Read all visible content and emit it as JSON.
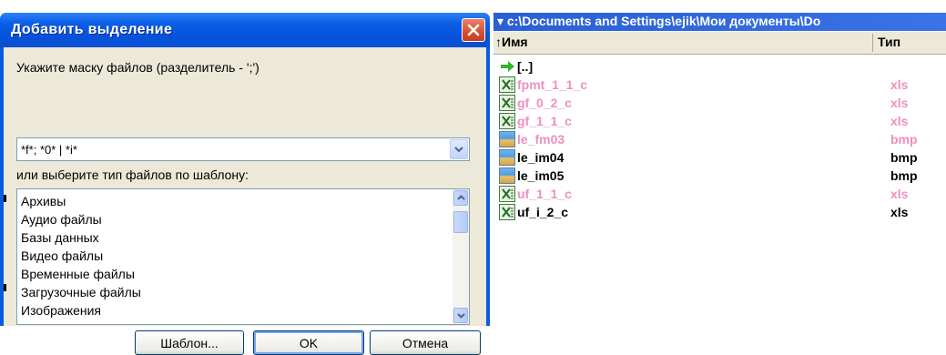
{
  "dialog": {
    "title": "Добавить выделение",
    "mask_label": "Укажите маску файлов (разделитель - ';')",
    "mask_value": "*f*; *0* | *i*",
    "template_label": "или выберите тип файлов по шаблону:",
    "file_types": [
      "Архивы",
      "Аудио файлы",
      "Базы данных",
      "Видео файлы",
      "Временные файлы",
      "Загрузочные файлы",
      "Изображения"
    ],
    "buttons": {
      "template": "Шаблон...",
      "ok": "OK",
      "cancel": "Отмена"
    }
  },
  "panel": {
    "path": "c:\\Documents and Settings\\ejik\\Мои документы\\Do",
    "columns": {
      "name": "Имя",
      "type": "Тип"
    },
    "parent": "[..]",
    "files": [
      {
        "name": "fpmt_1_1_c",
        "type": "xls",
        "icon": "excel-file-icon",
        "highlight": true
      },
      {
        "name": "gf_0_2_c",
        "type": "xls",
        "icon": "excel-file-icon",
        "highlight": true
      },
      {
        "name": "gf_1_1_c",
        "type": "xls",
        "icon": "excel-file-icon",
        "highlight": true
      },
      {
        "name": "le_fm03",
        "type": "bmp",
        "icon": "image-file-icon",
        "highlight": true
      },
      {
        "name": "le_im04",
        "type": "bmp",
        "icon": "image-file-icon",
        "highlight": false
      },
      {
        "name": "le_im05",
        "type": "bmp",
        "icon": "image-file-icon",
        "highlight": false
      },
      {
        "name": "uf_1_1_c",
        "type": "xls",
        "icon": "excel-file-icon",
        "highlight": true
      },
      {
        "name": "uf_i_2_c",
        "type": "xls",
        "icon": "excel-file-icon",
        "highlight": false
      }
    ]
  },
  "colors": {
    "highlight": "#ef8fc0",
    "title_bar": "#0552dc",
    "dialog_face": "#ece9d8"
  }
}
